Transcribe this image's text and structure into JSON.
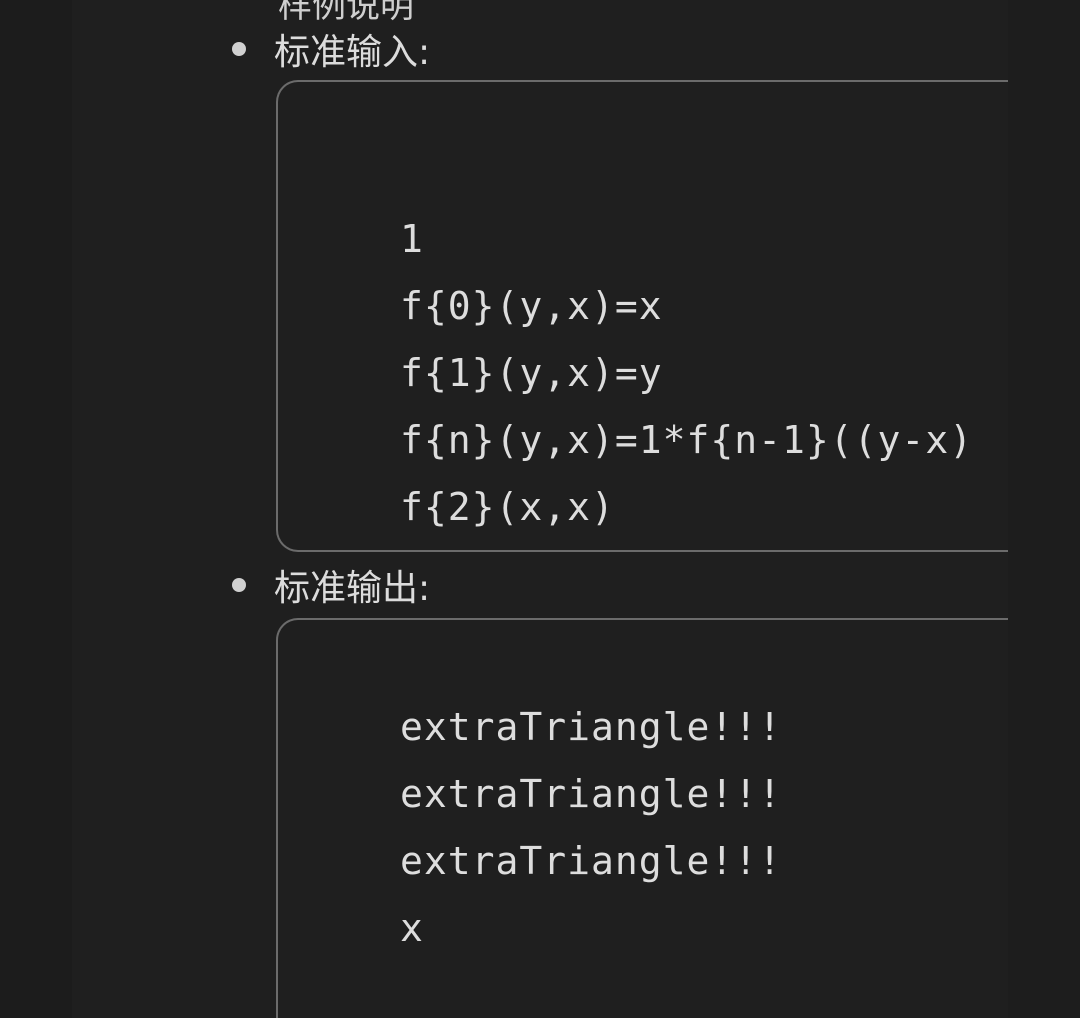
{
  "doc": {
    "cut_heading": "样例说明"
  },
  "sections": [
    {
      "label": "标准输入:",
      "lines": [
        "1",
        "f{0}(y,x)=x",
        "f{1}(y,x)=y",
        "f{n}(y,x)=1*f{n-1}((y-x)",
        "f{2}(x,x)"
      ]
    },
    {
      "label": "标准输出:",
      "lines": [
        "extraTriangle!!!",
        "extraTriangle!!!",
        "extraTriangle!!!",
        "x"
      ]
    }
  ]
}
